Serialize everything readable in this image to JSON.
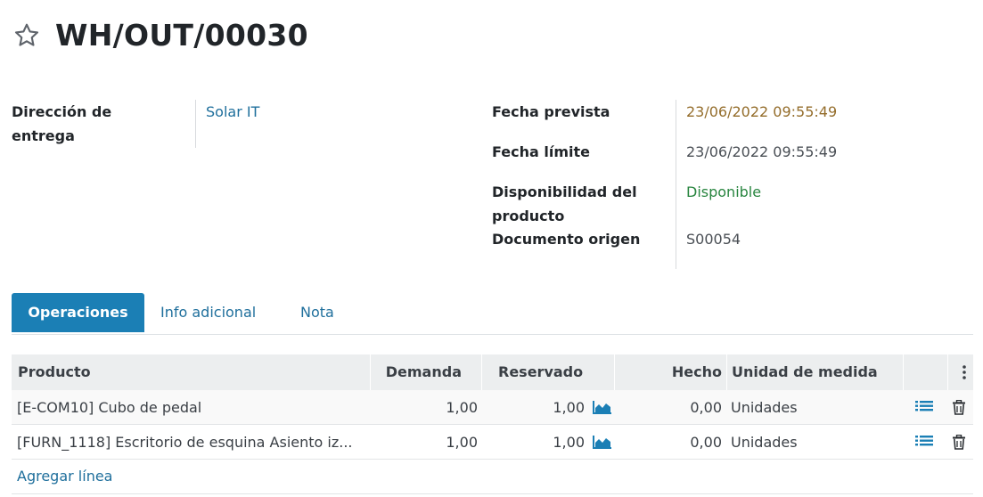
{
  "header": {
    "title": "WH/OUT/00030",
    "favorite_icon": "star-outline-icon"
  },
  "fields": {
    "delivery_address_label": "Dirección de entrega",
    "delivery_address_value": "Solar IT",
    "scheduled_date_label": "Fecha prevista",
    "scheduled_date_value": "23/06/2022 09:55:49",
    "deadline_label": "Fecha límite",
    "deadline_value": "23/06/2022 09:55:49",
    "availability_label": "Disponibilidad del producto",
    "availability_value": "Disponible",
    "source_document_label": "Documento origen",
    "source_document_value": "S00054"
  },
  "tabs": [
    {
      "label": "Operaciones",
      "active": true
    },
    {
      "label": "Info adicional",
      "active": false
    },
    {
      "label": "Nota",
      "active": false
    }
  ],
  "table": {
    "columns": {
      "product": "Producto",
      "demand": "Demanda",
      "reserved": "Reservado",
      "done": "Hecho",
      "uom": "Unidad de medida",
      "options_icon": "kebab-menu-icon"
    },
    "rows": [
      {
        "product": "[E-COM10] Cubo de pedal",
        "demand": "1,00",
        "reserved": "1,00",
        "done": "0,00",
        "uom": "Unidades"
      },
      {
        "product": "[FURN_1118] Escritorio de esquina Asiento iz...",
        "demand": "1,00",
        "reserved": "1,00",
        "done": "0,00",
        "uom": "Unidades"
      }
    ],
    "add_line": "Agregar línea"
  },
  "colors": {
    "accent": "#1b7fb5",
    "link": "#1f6f9c",
    "warning": "#946d2b",
    "success": "#28853f"
  }
}
